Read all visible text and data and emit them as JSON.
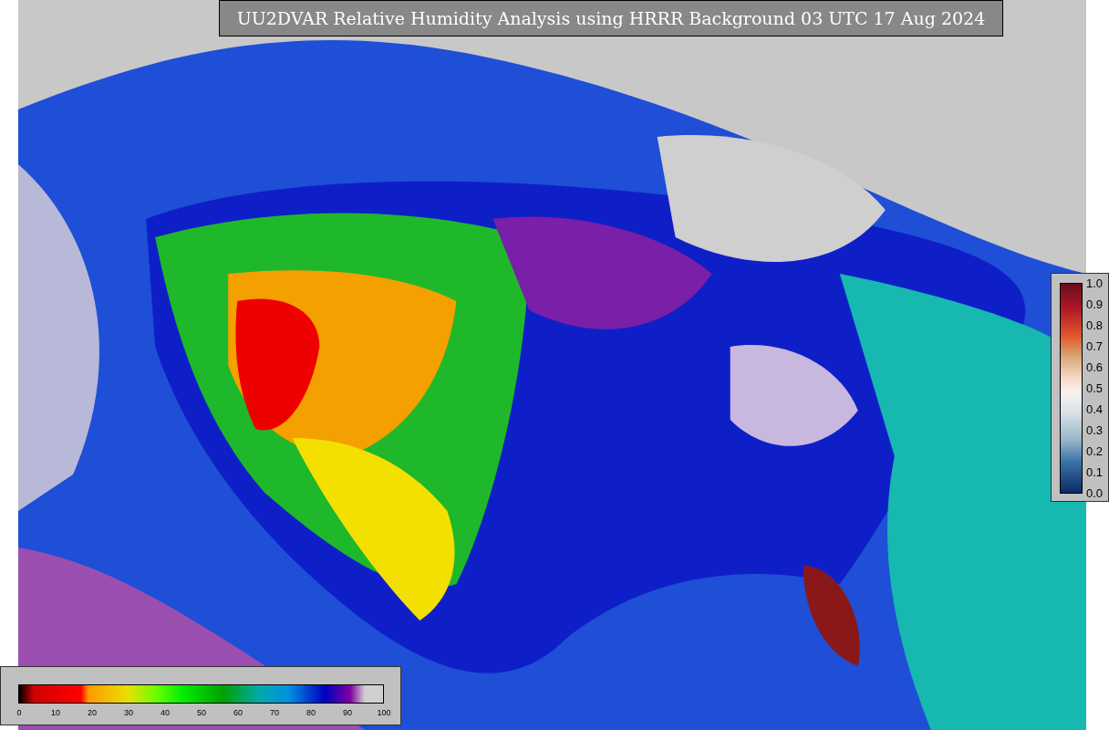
{
  "title": "UU2DVAR Relative Humidity Analysis using HRRR Background 03 UTC 17 Aug 2024",
  "bottom_colorbar": {
    "ticks": [
      "0",
      "10",
      "20",
      "30",
      "40",
      "50",
      "60",
      "70",
      "80",
      "90",
      "100"
    ]
  },
  "right_colorbar": {
    "ticks": [
      "1.0",
      "0.9",
      "0.8",
      "0.7",
      "0.6",
      "0.5",
      "0.4",
      "0.3",
      "0.2",
      "0.1",
      "0.0"
    ]
  }
}
